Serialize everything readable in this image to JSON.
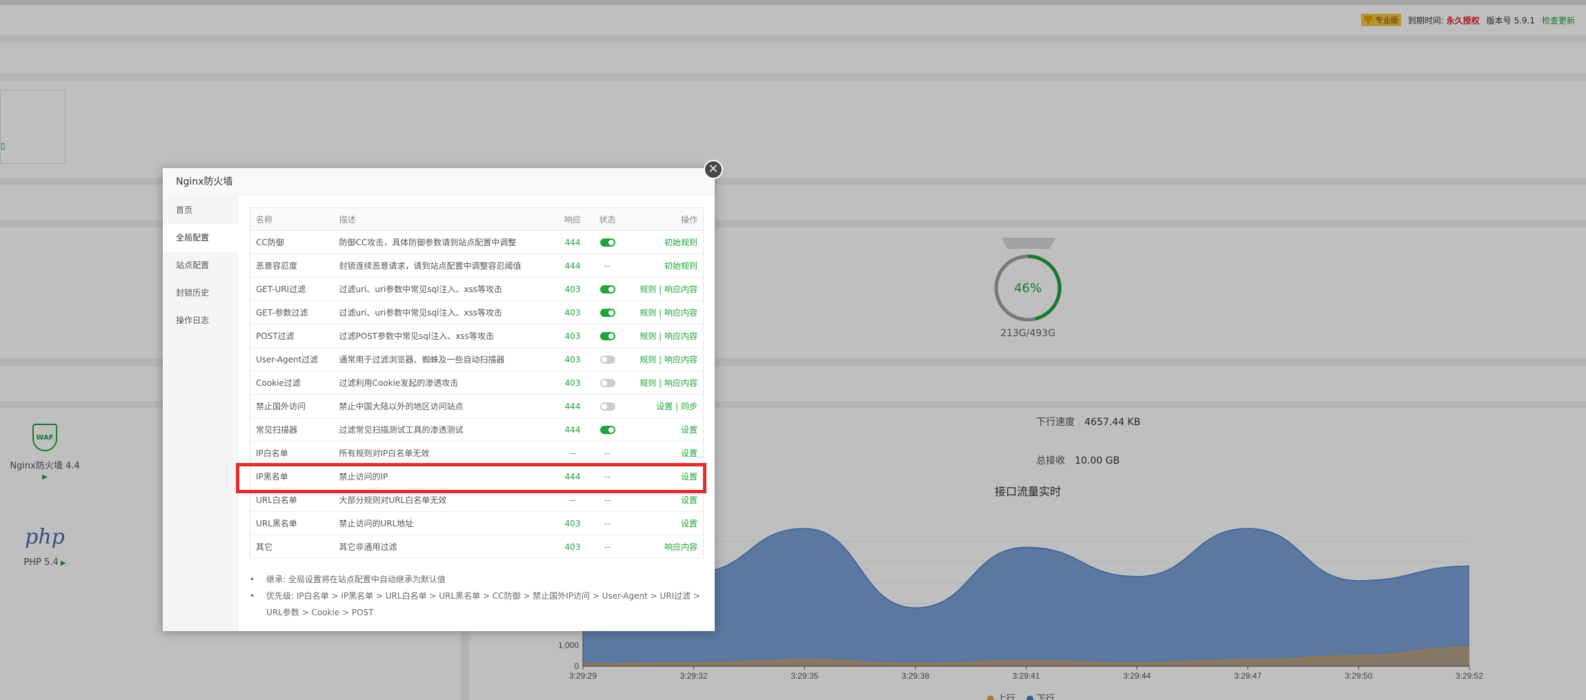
{
  "header": {
    "vip_label": "专业版",
    "expire_label": "到期时间:",
    "expire_value": "永久授权",
    "version_label": "版本号 5.9.1",
    "update_link": "检查更新"
  },
  "disk": {
    "percent_label": "46%",
    "percent": 0.46,
    "size": "213G/493G"
  },
  "software": [
    {
      "name": "Nginx防火墙 4.4",
      "icon": "WAF"
    },
    {
      "name": "PHP 5.4",
      "icon": "php"
    }
  ],
  "traffic": {
    "down_speed_label": "下行速度",
    "down_speed_value": "4657.44 KB",
    "total_recv_label": "总接收",
    "total_recv_value": "10.00 GB",
    "chart_title": "接口流量实时",
    "legend": {
      "up": "上行",
      "down": "下行"
    }
  },
  "chart_data": {
    "type": "area",
    "title": "接口流量实时",
    "x": [
      "3:29:29",
      "3:29:32",
      "3:29:35",
      "3:29:38",
      "3:29:41",
      "3:29:44",
      "3:29:47",
      "3:29:50",
      "3:29:52"
    ],
    "y_ticks": [
      "0",
      "1,000"
    ],
    "series": [
      {
        "name": "下行",
        "values": [
          4300,
          4500,
          6600,
          2800,
          5700,
          4300,
          6600,
          4100,
          4800
        ]
      },
      {
        "name": "上行",
        "values": [
          100,
          150,
          300,
          120,
          250,
          150,
          300,
          500,
          900
        ]
      }
    ],
    "colors": {
      "下行": "#4d82c8",
      "上行": "#e8a23a"
    }
  },
  "modal": {
    "title": "Nginx防火墙",
    "close_icon": "×",
    "menu": [
      "首页",
      "全局配置",
      "站点配置",
      "封锁历史",
      "操作日志"
    ],
    "active_menu": 1,
    "columns": {
      "name": "名称",
      "desc": "描述",
      "code": "响应",
      "status": "状态",
      "ops": "操作"
    },
    "rows": [
      {
        "name": "CC防御",
        "desc": "防御CC攻击，具体防御参数请到站点配置中调整",
        "code": "444",
        "status": "on",
        "ops": "初始规则"
      },
      {
        "name": "恶意容忍度",
        "desc": "封锁连续恶意请求，请到站点配置中调整容忍阈值",
        "code": "444",
        "status": "--",
        "ops": "初始规则"
      },
      {
        "name": "GET-URI过滤",
        "desc": "过滤uri、uri参数中常见sql注入、xss等攻击",
        "code": "403",
        "status": "on",
        "ops": "规则 | 响应内容"
      },
      {
        "name": "GET-参数过滤",
        "desc": "过滤uri、uri参数中常见sql注入、xss等攻击",
        "code": "403",
        "status": "on",
        "ops": "规则 | 响应内容"
      },
      {
        "name": "POST过滤",
        "desc": "过滤POST参数中常见sql注入、xss等攻击",
        "code": "403",
        "status": "on",
        "ops": "规则 | 响应内容"
      },
      {
        "name": "User-Agent过滤",
        "desc": "通常用于过滤浏览器、蜘蛛及一些自动扫描器",
        "code": "403",
        "status": "off",
        "ops": "规则 | 响应内容"
      },
      {
        "name": "Cookie过滤",
        "desc": "过滤利用Cookie发起的渗透攻击",
        "code": "403",
        "status": "off",
        "ops": "规则 | 响应内容"
      },
      {
        "name": "禁止国外访问",
        "desc": "禁止中国大陆以外的地区访问站点",
        "code": "444",
        "status": "off",
        "ops": "设置 | 同步"
      },
      {
        "name": "常见扫描器",
        "desc": "过滤常见扫描测试工具的渗透测试",
        "code": "444",
        "status": "on",
        "ops": "设置"
      },
      {
        "name": "IP白名单",
        "desc": "所有规则对IP白名单无效",
        "code": "--",
        "status": "--",
        "ops": "设置"
      },
      {
        "name": "IP黑名单",
        "desc": "禁止访问的IP",
        "code": "444",
        "status": "--",
        "ops": "设置"
      },
      {
        "name": "URL白名单",
        "desc": "大部分规则对URL白名单无效",
        "code": "--",
        "status": "--",
        "ops": "设置"
      },
      {
        "name": "URL黑名单",
        "desc": "禁止访问的URL地址",
        "code": "403",
        "status": "--",
        "ops": "设置"
      },
      {
        "name": "其它",
        "desc": "其它非通用过滤",
        "code": "403",
        "status": "--",
        "ops": "响应内容"
      }
    ],
    "notes": [
      "继承: 全局设置将在站点配置中自动继承为默认值",
      "优先级: IP白名单 > IP黑名单 > URL白名单 > URL黑名单 > CC防御 > 禁止国外IP访问 > User-Agent > URI过滤 > URL参数 > Cookie > POST"
    ]
  }
}
